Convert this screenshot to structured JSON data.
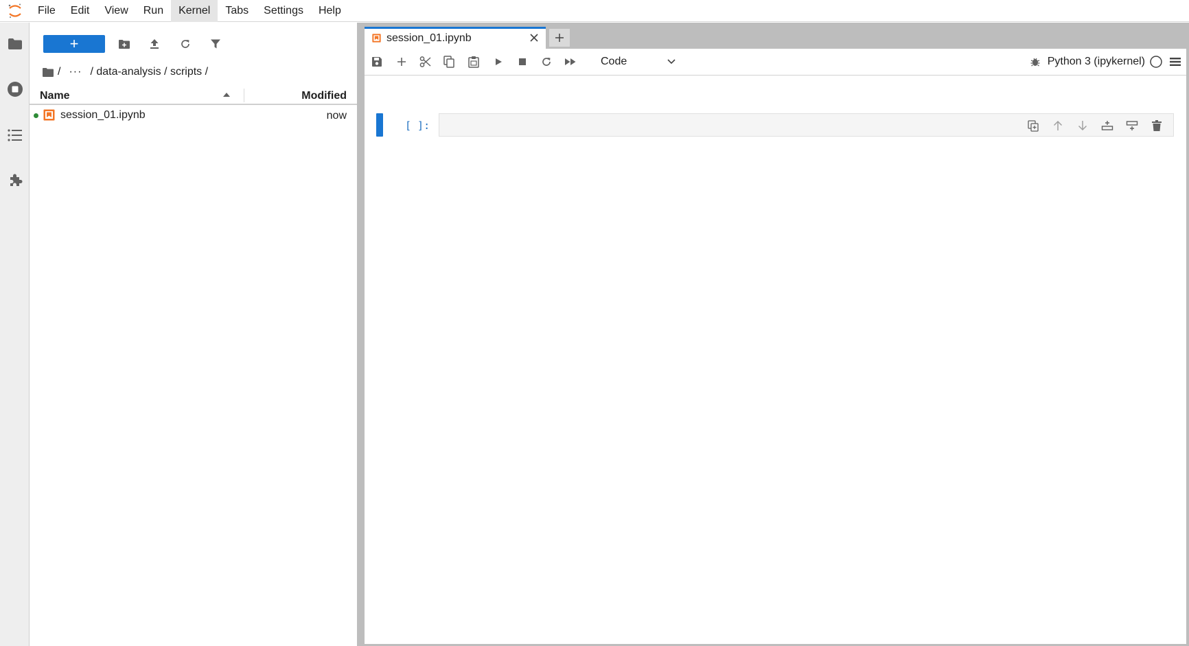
{
  "menubar": {
    "items": [
      "File",
      "Edit",
      "View",
      "Run",
      "Kernel",
      "Tabs",
      "Settings",
      "Help"
    ],
    "active": "Kernel"
  },
  "activitybar": {
    "icons": [
      "folder-icon",
      "running-sessions-icon",
      "table-of-contents-icon",
      "extensions-icon"
    ]
  },
  "filebrowser": {
    "new_button_label": "+",
    "breadcrumb": {
      "root_sep": "/",
      "ellipsis": "···",
      "path": "/ data-analysis / scripts /"
    },
    "columns": {
      "name": "Name",
      "modified": "Modified"
    },
    "files": [
      {
        "name": "session_01.ipynb",
        "modified": "now",
        "running": true
      }
    ]
  },
  "tabs": [
    {
      "label": "session_01.ipynb",
      "active": true
    }
  ],
  "notebook": {
    "cell_type": "Code",
    "kernel": "Python 3 (ipykernel)",
    "cells": [
      {
        "prompt": "[ ]:",
        "source": ""
      }
    ]
  },
  "colors": {
    "accent": "#1976d2",
    "notebook_icon": "#f37626",
    "running_dot": "#2e8b37",
    "prompt": "#1e6fc0"
  }
}
